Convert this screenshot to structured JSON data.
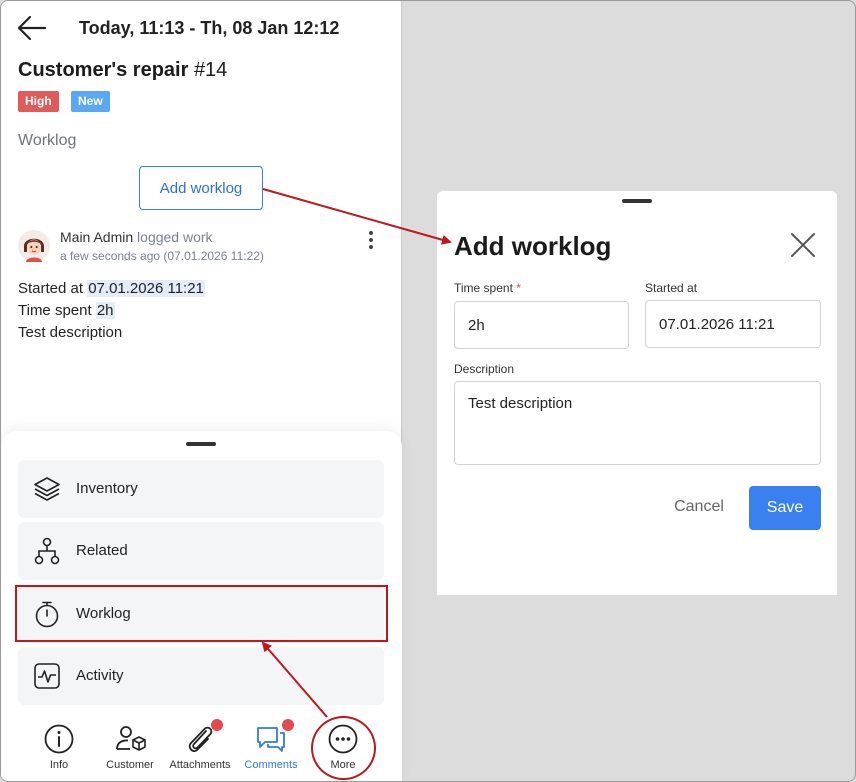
{
  "header": {
    "title": "Today, 11:13 - Th, 08 Jan 12:12"
  },
  "order": {
    "title": "Customer's repair",
    "number": "#14",
    "priority": "High",
    "status": "New"
  },
  "worklog_section": {
    "label": "Worklog",
    "add_button": "Add worklog"
  },
  "log_entry": {
    "author": "Main Admin",
    "action": "logged work",
    "time": "a few seconds ago (07.01.2026 11:22)",
    "started_label": "Started at",
    "started_value": "07.01.2026 11:21",
    "spent_label": "Time spent",
    "spent_value": "2h",
    "description": "Test description"
  },
  "menu": {
    "items": [
      {
        "label": "Inventory",
        "icon": "layers-icon"
      },
      {
        "label": "Related",
        "icon": "hierarchy-icon"
      },
      {
        "label": "Worklog",
        "icon": "stopwatch-icon"
      },
      {
        "label": "Activity",
        "icon": "activity-icon"
      }
    ]
  },
  "nav": {
    "items": [
      {
        "label": "Info",
        "icon": "info-icon"
      },
      {
        "label": "Customer",
        "icon": "customer-icon"
      },
      {
        "label": "Attachments",
        "icon": "paperclip-icon"
      },
      {
        "label": "Comments",
        "icon": "comments-icon"
      },
      {
        "label": "More",
        "icon": "more-icon"
      }
    ],
    "active": "Comments"
  },
  "dialog": {
    "title": "Add worklog",
    "time_spent_label": "Time spent",
    "required_mark": "*",
    "time_spent_value": "2h",
    "started_at_label": "Started at",
    "started_at_value": "07.01.2026 11:21",
    "description_label": "Description",
    "description_value": "Test description",
    "cancel": "Cancel",
    "save": "Save"
  },
  "colors": {
    "accent": "#3a80f0",
    "badge_high": "#e25b5b",
    "badge_new": "#5aa8f2",
    "annotation_red": "#c0161c",
    "notification_dot": "#e5484d"
  }
}
